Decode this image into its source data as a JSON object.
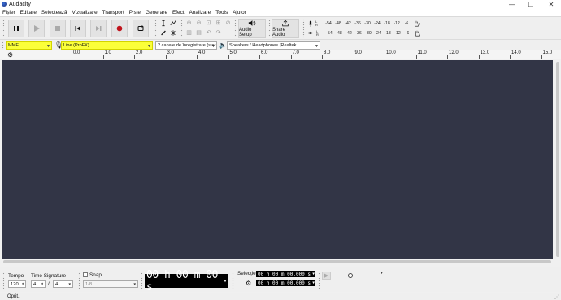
{
  "window": {
    "title": "Audacity",
    "minimize": "—",
    "maximize": "☐",
    "close": "✕"
  },
  "menu": [
    "Fișier",
    "Editare",
    "Selectează",
    "Vizualizare",
    "Transport",
    "Piste",
    "Generare",
    "Efect",
    "Analizare",
    "Tools",
    "Ajutor"
  ],
  "toolbar": {
    "audio_setup_label": "Audio Setup",
    "share_audio_label": "Share Audio",
    "meter_ticks": [
      "-54",
      "-48",
      "-42",
      "-36",
      "-30",
      "-24",
      "-18",
      "-12",
      "-6"
    ],
    "meter_lr": [
      "L",
      "R"
    ]
  },
  "devices": {
    "host": "MME",
    "recording_device": "Line (ProFX)",
    "channels": "2 canale de înregistrare (ster",
    "playback_device": "Speakers / Headphones (Realtek"
  },
  "ruler": {
    "ticks": [
      "0,0",
      "1,0",
      "2,0",
      "3,0",
      "4,0",
      "5,0",
      "6,0",
      "7,0",
      "8,0",
      "9,0",
      "10,0",
      "11,0",
      "12,0",
      "13,0",
      "14,0",
      "15,0"
    ]
  },
  "bottom": {
    "tempo_label": "Tempo",
    "tempo_value": "120",
    "time_signature_label": "Time Signature",
    "ts_numerator": "4",
    "ts_separator": "/",
    "ts_denominator": "4",
    "snap_label": "Snap",
    "snap_value": "1/8",
    "big_time": "00 h 00 m 00 s",
    "selection_label": "Selecție",
    "selection_start": "00 h 00 m 00.000 s",
    "selection_end": "00 h 00 m 00.000 s"
  },
  "status": {
    "text": "Oprit."
  },
  "colors": {
    "track_bg": "#323546",
    "highlight": "#fbff3a"
  }
}
